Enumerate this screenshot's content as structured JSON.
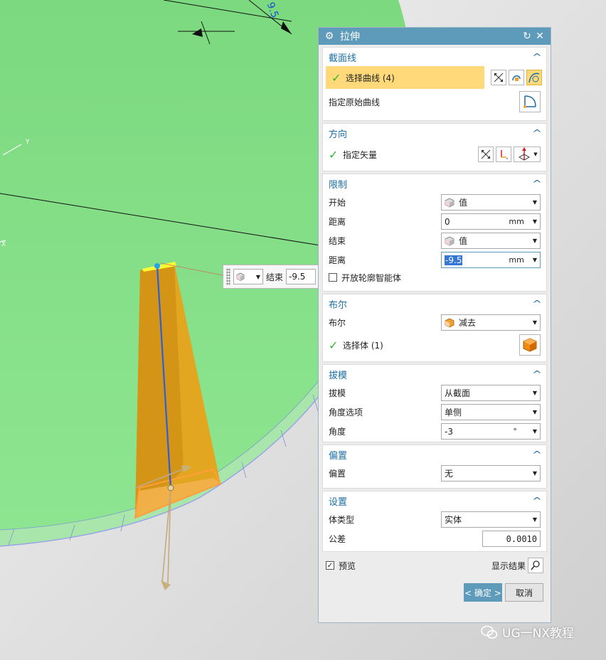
{
  "viewport": {
    "dimension_text": "9.5",
    "axis_label_y": "Y",
    "axis_label_x": "X"
  },
  "onscreen_input": {
    "label": "结束",
    "value": "-9.5"
  },
  "dialog": {
    "title": "拉伸",
    "sections": {
      "section_curve": {
        "title": "截面线",
        "select_curve_label": "选择曲线 (4)",
        "specify_original_label": "指定原始曲线"
      },
      "direction": {
        "title": "方向",
        "vector_label": "指定矢量"
      },
      "limits": {
        "title": "限制",
        "start_label": "开始",
        "start_value": "值",
        "distance1_label": "距离",
        "distance1_value": "0",
        "distance1_unit": "mm",
        "end_label": "结束",
        "end_value": "值",
        "distance2_label": "距离",
        "distance2_value": "-9.5",
        "distance2_unit": "mm",
        "open_profile_label": "开放轮廓智能体"
      },
      "boolean": {
        "title": "布尔",
        "bool_label": "布尔",
        "bool_value": "减去",
        "select_body_label": "选择体 (1)"
      },
      "draft": {
        "title": "拔模",
        "draft_label": "拔模",
        "draft_value": "从截面",
        "angle_option_label": "角度选项",
        "angle_option_value": "单侧",
        "angle_label": "角度",
        "angle_value": "-3",
        "angle_unit": "°"
      },
      "offset": {
        "title": "偏置",
        "offset_label": "偏置",
        "offset_value": "无"
      },
      "settings": {
        "title": "设置",
        "body_type_label": "体类型",
        "body_type_value": "实体",
        "tolerance_label": "公差",
        "tolerance_value": "0.0010"
      }
    },
    "footer": {
      "preview_label": "预览",
      "show_result_label": "显示结果",
      "ok_label": "< 确定 >",
      "cancel_label": "取消"
    }
  },
  "watermark": {
    "text": "UG一NX教程"
  },
  "colors": {
    "title_bar": "#5e9ab9",
    "section_title": "#1c6ea4",
    "highlight": "#ffd97a",
    "viewport_green": "#84df88",
    "viewport_bg": "#d9d9d9",
    "feature_orange": "#e8a21a"
  }
}
